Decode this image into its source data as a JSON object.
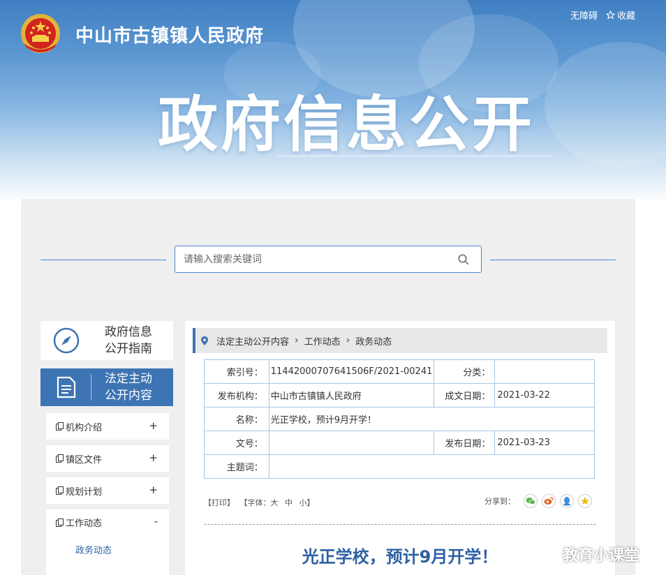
{
  "header": {
    "site_name": "中山市古镇镇人民政府",
    "accessibility_label": "无障碍",
    "favorite_label": "收藏",
    "banner_title": "政府信息公开"
  },
  "search": {
    "placeholder": "请输入搜索关键词"
  },
  "sidebar": {
    "guide_label": "政府信息\n公开指南",
    "active_label": "法定主动\n公开内容",
    "items": [
      {
        "label": "机构介绍",
        "sign": "+"
      },
      {
        "label": "镇区文件",
        "sign": "+"
      },
      {
        "label": "规划计划",
        "sign": "+"
      },
      {
        "label": "工作动态",
        "sign": "-"
      }
    ],
    "sub_item": "政务动态"
  },
  "breadcrumb": {
    "items": [
      "法定主动公开内容",
      "工作动态",
      "政务动态"
    ]
  },
  "meta": {
    "index_label": "索引号：",
    "index_value": "11442000707641506F/2021-00241",
    "category_label": "分类：",
    "category_value": "",
    "publisher_label": "发布机构：",
    "publisher_value": "中山市古镇镇人民政府",
    "created_label": "成文日期：",
    "created_value": "2021-03-22",
    "name_label": "名称：",
    "name_value": "光正学校，预计9月开学！",
    "docno_label": "文号：",
    "docno_value": "",
    "published_label": "发布日期：",
    "published_value": "2021-03-23",
    "subject_label": "主题词：",
    "subject_value": ""
  },
  "tools": {
    "print": "【打印】",
    "font_prefix": "【字体：",
    "font_large": "大",
    "font_medium": "中",
    "font_small": "小",
    "font_suffix": "】",
    "share_label": "分享到："
  },
  "colors": {
    "primary": "#3d74b3",
    "title": "#2d60a3",
    "wechat": "#5bb84f",
    "weibo": "#e2682a",
    "qq": "#3d8fd8",
    "qzone": "#f2b90c"
  },
  "article": {
    "title": "光正学校，预计9月开学！"
  },
  "watermark": "教育小课堂"
}
